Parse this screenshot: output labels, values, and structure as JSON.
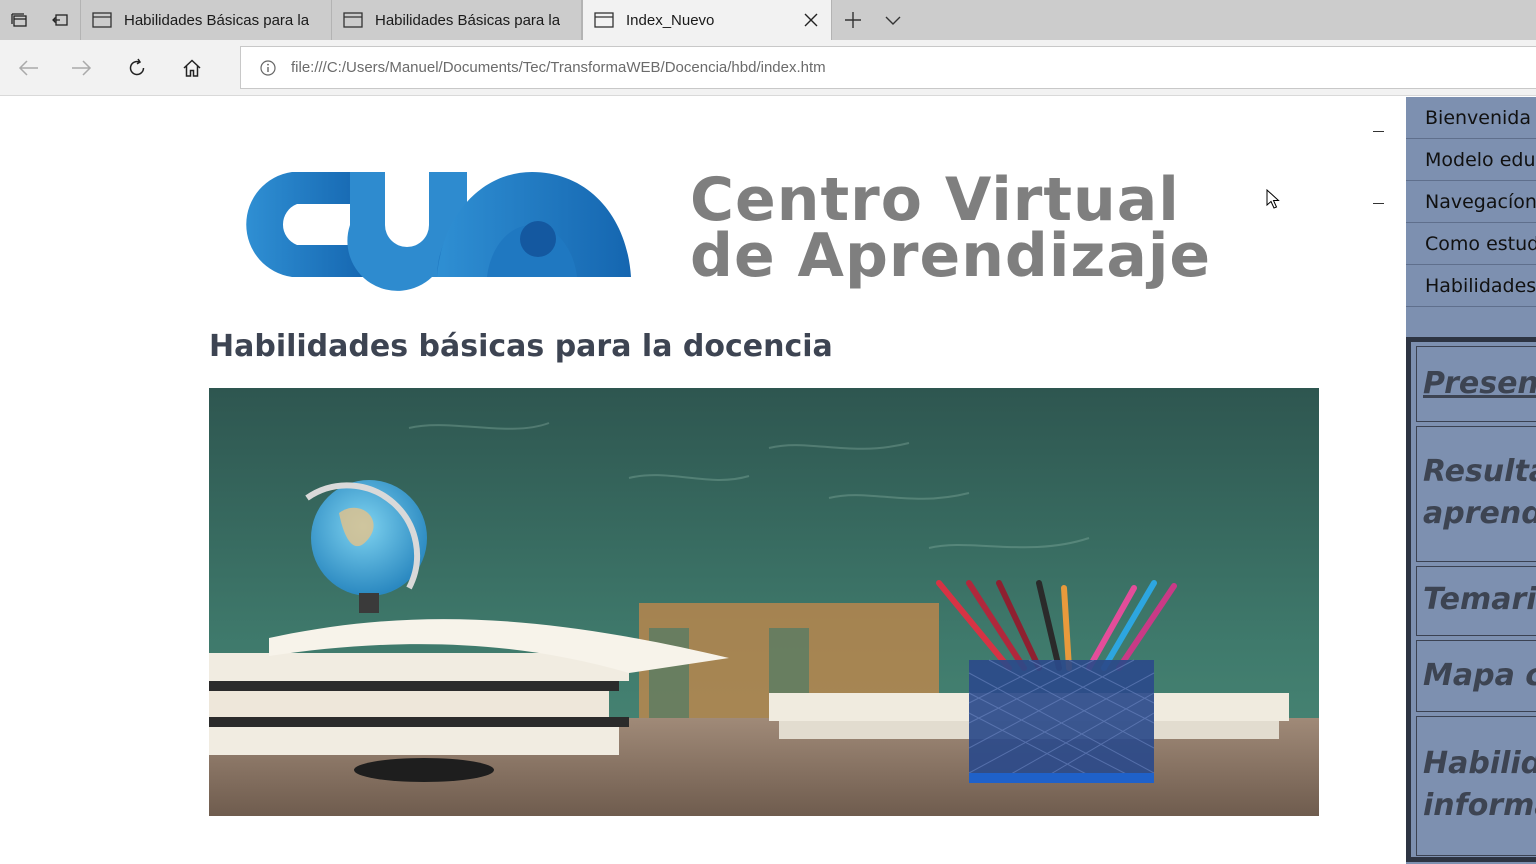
{
  "browser": {
    "tabs": [
      {
        "title": "Habilidades Básicas para la"
      },
      {
        "title": "Habilidades Básicas para la"
      },
      {
        "title": "Index_Nuevo"
      }
    ],
    "address": "file:///C:/Users/Manuel/Documents/Tec/TransformaWEB/Docencia/hbd/index.htm"
  },
  "logo": {
    "line1": "Centro Virtual",
    "line2": "de Aprendizaje",
    "brand_blue": "#1f78c1",
    "brand_gray": "#7f7f7f"
  },
  "page": {
    "title": "Habilidades básicas para la docencia"
  },
  "menu": {
    "items": [
      {
        "label": "Bienvenida"
      },
      {
        "label": "Modelo edu"
      },
      {
        "label": "Navegacíon"
      },
      {
        "label": "Como estud"
      },
      {
        "label": "Habilidades"
      }
    ]
  },
  "toc": {
    "items": [
      {
        "label": "Presen"
      },
      {
        "label": "Resulta aprend"
      },
      {
        "label": "Temari"
      },
      {
        "label": "Mapa c"
      },
      {
        "label": "Habilid informa"
      }
    ]
  },
  "colors": {
    "menu_bg": "#7d90b0",
    "title_text": "#3d4452"
  }
}
